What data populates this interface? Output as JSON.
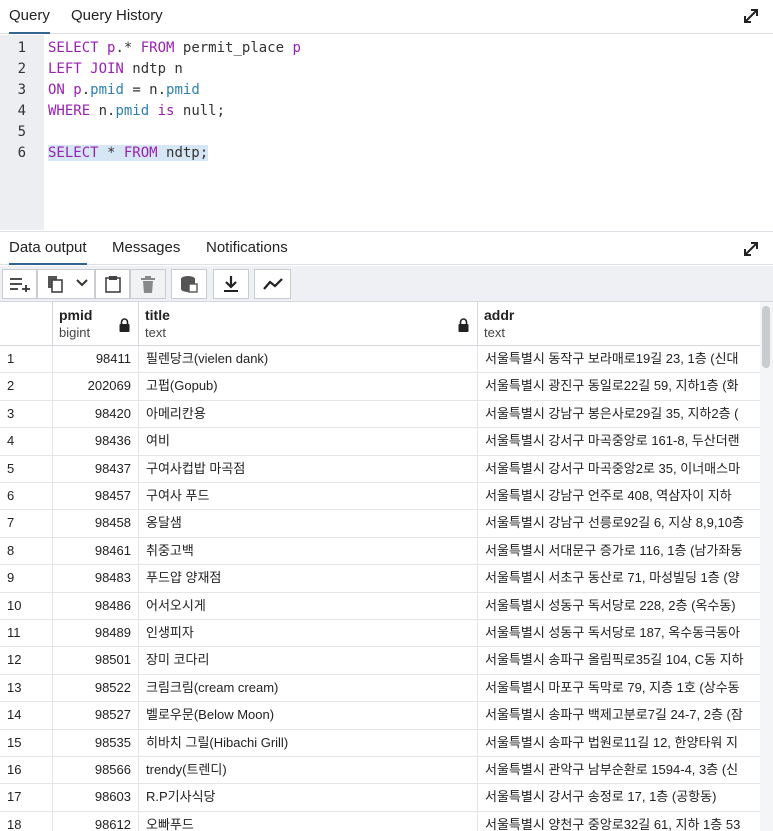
{
  "query_tabs": [
    {
      "label": "Query",
      "active": true
    },
    {
      "label": "Query History",
      "active": false
    }
  ],
  "editor": {
    "lines": [
      "1",
      "2",
      "3",
      "4",
      "5",
      "6"
    ],
    "code": [
      {
        "parts": [
          {
            "t": "SELECT",
            "k": "kw"
          },
          {
            "t": " "
          },
          {
            "t": "p",
            "k": "alias"
          },
          {
            "t": ".* "
          },
          {
            "t": "FROM",
            "k": "kw"
          },
          {
            "t": " permit_place "
          },
          {
            "t": "p",
            "k": "alias"
          }
        ]
      },
      {
        "parts": [
          {
            "t": "LEFT JOIN",
            "k": "kw"
          },
          {
            "t": " ndtp n"
          }
        ]
      },
      {
        "parts": [
          {
            "t": "ON",
            "k": "kw"
          },
          {
            "t": " "
          },
          {
            "t": "p",
            "k": "alias"
          },
          {
            "t": "."
          },
          {
            "t": "pmid",
            "k": "fld"
          },
          {
            "t": " = n."
          },
          {
            "t": "pmid",
            "k": "fld"
          }
        ]
      },
      {
        "parts": [
          {
            "t": "WHERE",
            "k": "kw"
          },
          {
            "t": " n."
          },
          {
            "t": "pmid",
            "k": "fld"
          },
          {
            "t": " "
          },
          {
            "t": "is",
            "k": "kw"
          },
          {
            "t": " null;"
          }
        ]
      },
      {
        "parts": []
      },
      {
        "parts": [
          {
            "t": "SELECT",
            "k": "kw"
          },
          {
            "t": " * "
          },
          {
            "t": "FROM",
            "k": "kw"
          },
          {
            "t": " ndtp;"
          }
        ],
        "highlight": true
      }
    ]
  },
  "output_tabs": [
    {
      "label": "Data output",
      "active": true
    },
    {
      "label": "Messages",
      "active": false
    },
    {
      "label": "Notifications",
      "active": false
    }
  ],
  "toolbar_icons": [
    "add-row-icon",
    "copy-icon",
    "dropdown-icon",
    "paste-icon",
    "delete-icon",
    "save-data-icon",
    "download-icon",
    "graph-icon"
  ],
  "columns": [
    {
      "name": "pmid",
      "type": "bigint",
      "locked": true
    },
    {
      "name": "title",
      "type": "text",
      "locked": true
    },
    {
      "name": "addr",
      "type": "text",
      "locked": false
    }
  ],
  "rows": [
    {
      "n": "1",
      "pmid": "98411",
      "title": "필렌당크(vielen dank)",
      "addr": "서울특별시 동작구 보라매로19길 23, 1층 (신대"
    },
    {
      "n": "2",
      "pmid": "202069",
      "title": "고펍(Gopub)",
      "addr": "서울특별시 광진구 동일로22길 59, 지하1층 (화"
    },
    {
      "n": "3",
      "pmid": "98420",
      "title": "아메리칸용",
      "addr": "서울특별시 강남구 봉은사로29길 35, 지하2층 ("
    },
    {
      "n": "4",
      "pmid": "98436",
      "title": "여비",
      "addr": "서울특별시 강서구 마곡중앙로 161-8, 두산더랜"
    },
    {
      "n": "5",
      "pmid": "98437",
      "title": "구여사컵밥 마곡점",
      "addr": "서울특별시 강서구 마곡중앙2로 35, 이너매스마"
    },
    {
      "n": "6",
      "pmid": "98457",
      "title": "구여사 푸드",
      "addr": "서울특별시 강남구 언주로 408, 역삼자이 지하"
    },
    {
      "n": "7",
      "pmid": "98458",
      "title": "옹달샘",
      "addr": "서울특별시 강남구 선릉로92길 6, 지상 8,9,10층"
    },
    {
      "n": "8",
      "pmid": "98461",
      "title": "취중고백",
      "addr": "서울특별시 서대문구 증가로 116, 1층 (남가좌동"
    },
    {
      "n": "9",
      "pmid": "98483",
      "title": "푸드얍 양재점",
      "addr": "서울특별시 서초구 동산로 71, 마성빌딩 1층 (양"
    },
    {
      "n": "10",
      "pmid": "98486",
      "title": "어서오시게",
      "addr": "서울특별시 성동구 독서당로 228, 2층 (옥수동)"
    },
    {
      "n": "11",
      "pmid": "98489",
      "title": "인생피자",
      "addr": "서울특별시 성동구 독서당로 187, 옥수동극동아"
    },
    {
      "n": "12",
      "pmid": "98501",
      "title": "장미 코다리",
      "addr": "서울특별시 송파구 올림픽로35길 104, C동 지하"
    },
    {
      "n": "13",
      "pmid": "98522",
      "title": "크림크림(cream cream)",
      "addr": "서울특별시 마포구 독막로 79, 지층 1호 (상수동"
    },
    {
      "n": "14",
      "pmid": "98527",
      "title": "벨로우문(Below Moon)",
      "addr": "서울특별시 송파구 백제고분로7길 24-7, 2층 (잠"
    },
    {
      "n": "15",
      "pmid": "98535",
      "title": "히바치 그릴(Hibachi Grill)",
      "addr": "서울특별시 송파구 법원로11길 12, 한양타워 지"
    },
    {
      "n": "16",
      "pmid": "98566",
      "title": "trendy(트렌디)",
      "addr": "서울특별시 관악구 남부순환로 1594-4, 3층 (신"
    },
    {
      "n": "17",
      "pmid": "98603",
      "title": "R.P기사식당",
      "addr": "서울특별시 강서구 송정로 17, 1층 (공항동)"
    },
    {
      "n": "18",
      "pmid": "98612",
      "title": "오빠푸드",
      "addr": "서울특별시 양천구 중앙로32길 61, 지하 1층 53"
    }
  ]
}
